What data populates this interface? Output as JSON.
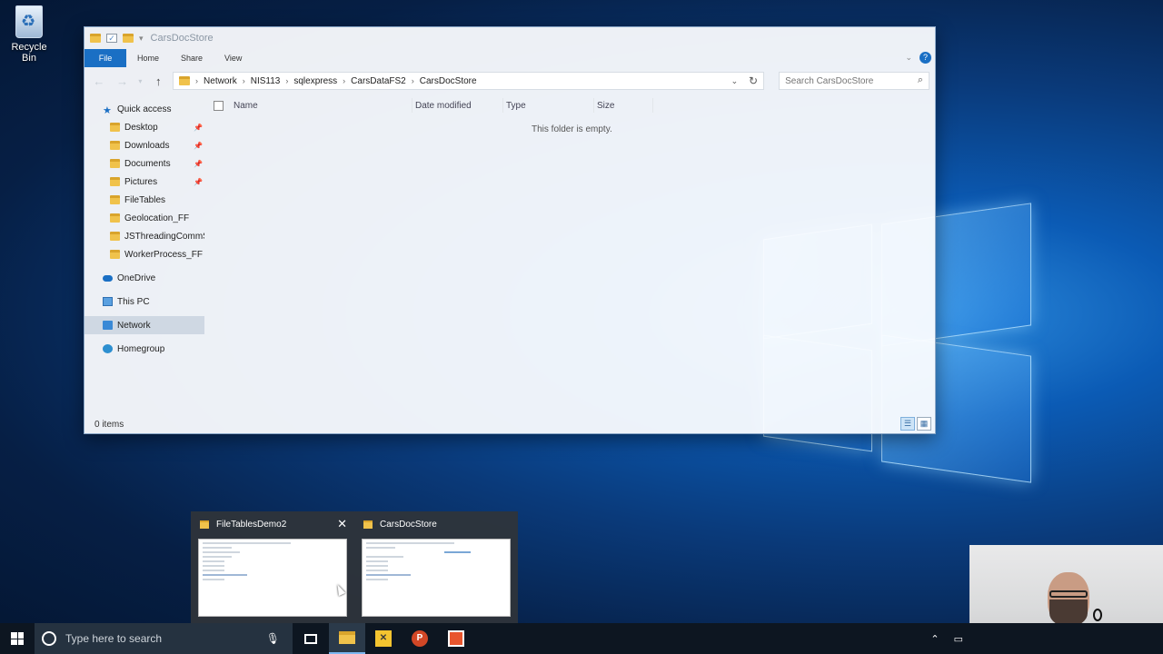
{
  "desktop": {
    "recycle_bin_label": "Recycle Bin"
  },
  "explorer": {
    "title": "CarsDocStore",
    "ribbon_tabs": [
      "File",
      "Home",
      "Share",
      "View"
    ],
    "breadcrumbs": [
      "Network",
      "NIS113",
      "sqlexpress",
      "CarsDataFS2",
      "CarsDocStore"
    ],
    "search_placeholder": "Search CarsDocStore",
    "nav": {
      "quick_access": "Quick access",
      "pinned": [
        {
          "label": "Desktop",
          "pinned": true
        },
        {
          "label": "Downloads",
          "pinned": true
        },
        {
          "label": "Documents",
          "pinned": true
        },
        {
          "label": "Pictures",
          "pinned": true
        },
        {
          "label": "FileTables",
          "pinned": false
        },
        {
          "label": "Geolocation_FF",
          "pinned": false
        },
        {
          "label": "JSThreadingCommS",
          "pinned": false
        },
        {
          "label": "WorkerProcess_FF",
          "pinned": false
        }
      ],
      "onedrive": "OneDrive",
      "this_pc": "This PC",
      "network": "Network",
      "homegroup": "Homegroup",
      "selected": "Network"
    },
    "columns": [
      "Name",
      "Date modified",
      "Type",
      "Size"
    ],
    "empty_message": "This folder is empty.",
    "status": "0 items"
  },
  "task_preview": {
    "items": [
      {
        "title": "FileTablesDemo2",
        "show_close": true
      },
      {
        "title": "CarsDocStore",
        "show_close": false
      }
    ]
  },
  "taskbar": {
    "search_placeholder": "Type here to search",
    "pinned_apps": [
      "task-view",
      "file-explorer",
      "sql-server-management-studio",
      "powerpoint",
      "screen-recorder"
    ],
    "active_app": "file-explorer"
  },
  "colors": {
    "accent": "#1a6fc4",
    "taskbar": "#0d1621",
    "folder": "#f0c24b"
  }
}
